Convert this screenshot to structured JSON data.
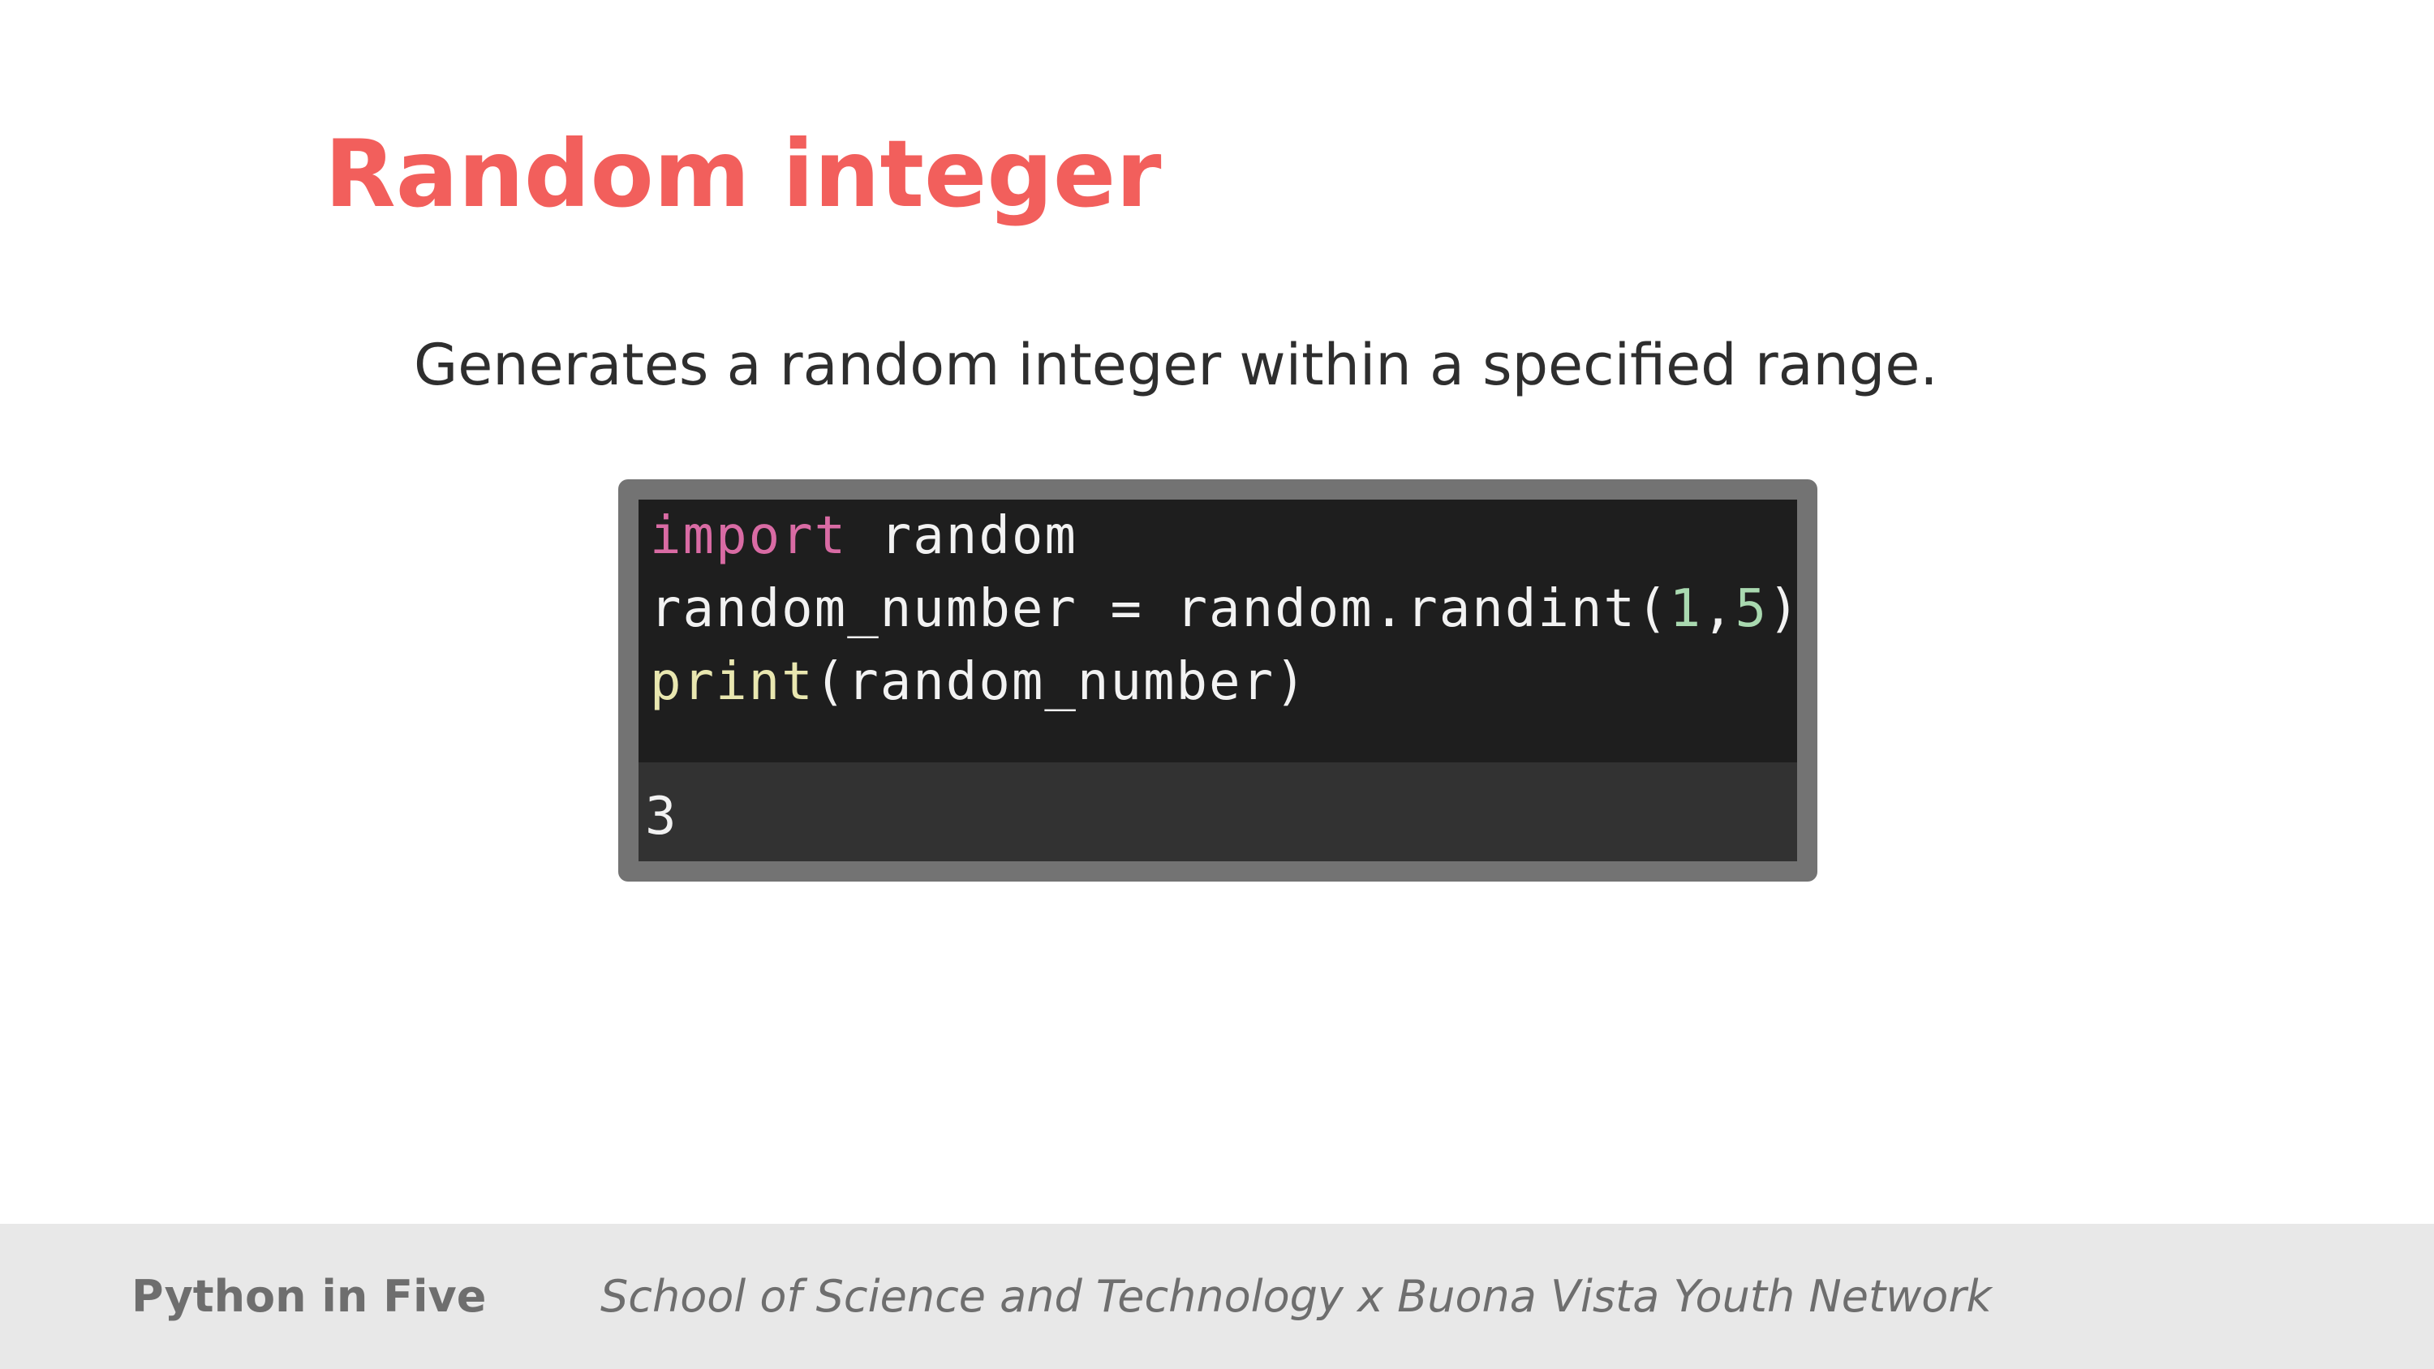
{
  "slide": {
    "title": "Random integer",
    "description": "Generates a random integer within a specified range."
  },
  "code": {
    "line1": {
      "keyword": "import",
      "rest": " random"
    },
    "line2": {
      "before": "random_number = random.randint(",
      "arg1": "1",
      "comma": ",",
      "arg2": "5",
      "after": ")"
    },
    "line3": {
      "func": "print",
      "rest": "(random_number)"
    },
    "output": "3"
  },
  "footer": {
    "brand": "Python in Five",
    "credit": "School of Science and Technology x Buona Vista Youth Network"
  },
  "colors": {
    "title": "#f25f5c",
    "keyword": "#d96ba4",
    "function": "#e9e7b0",
    "number": "#a9d9b0",
    "editor_background": "#1e1e1e",
    "output_background": "#323232",
    "frame": "#737373",
    "footer_background": "#e8e8e8"
  }
}
